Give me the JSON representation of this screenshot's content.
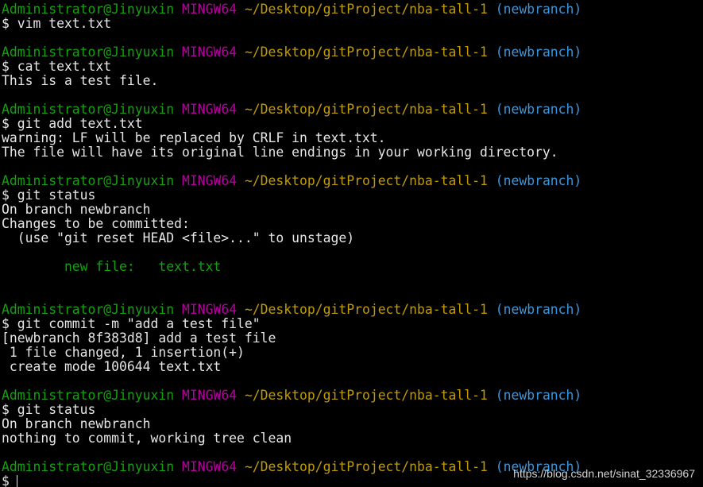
{
  "colors": {
    "background": "#000000",
    "text": "#e6e6e6",
    "user_host": "#13a10e",
    "system": "#b4009e",
    "path": "#c19c00",
    "branch": "#3a96dd",
    "staged": "#13a10e"
  },
  "prompt": {
    "user_host": "Administrator@Jinyuxin",
    "system": "MINGW64",
    "path": "~/Desktop/gitProject/nba-tall-1",
    "branch": "(newbranch)"
  },
  "commands": {
    "c1": "$ vim text.txt",
    "c2": "$ cat text.txt",
    "c3": "$ git add text.txt",
    "c4": "$ git status",
    "c5": "$ git commit -m \"add a test file\"",
    "c6": "$ git status",
    "c7": "$"
  },
  "output": {
    "cat_line": "This is a test file.",
    "add_warning_1": "warning: LF will be replaced by CRLF in text.txt.",
    "add_warning_2": "The file will have its original line endings in your working directory.",
    "status1_branch": "On branch newbranch",
    "status1_changes": "Changes to be committed:",
    "status1_hint": "  (use \"git reset HEAD <file>...\" to unstage)",
    "status1_newfile": "        new file:   text.txt",
    "commit_1": "[newbranch 8f383d8] add a test file",
    "commit_2": " 1 file changed, 1 insertion(+)",
    "commit_3": " create mode 100644 text.txt",
    "status2_branch": "On branch newbranch",
    "status2_clean": "nothing to commit, working tree clean"
  },
  "watermark": "https://blog.csdn.net/sinat_32336967"
}
